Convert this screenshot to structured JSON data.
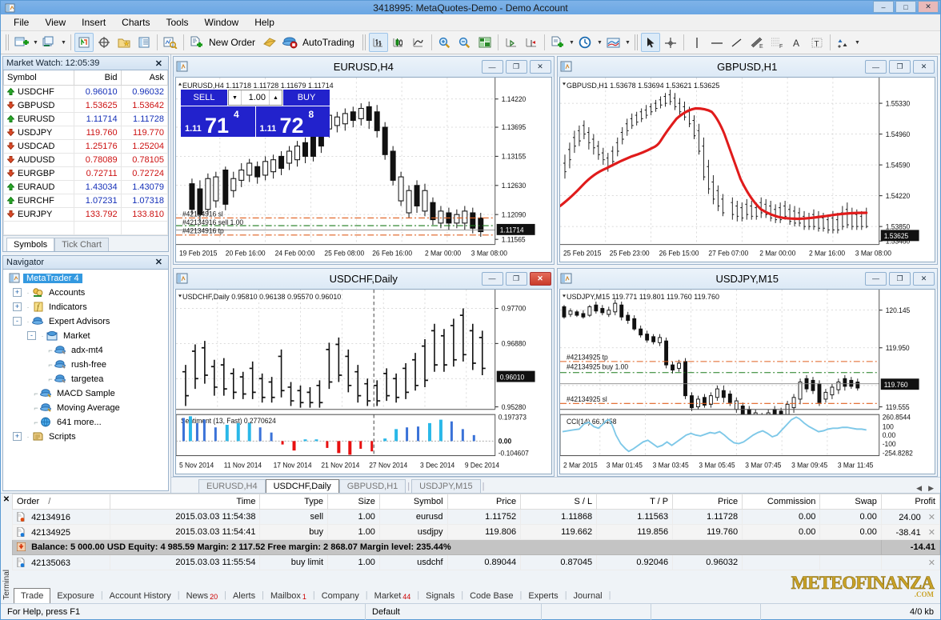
{
  "window": {
    "title": "3418995: MetaQuotes-Demo - Demo Account",
    "minimize": "–",
    "maximize": "□",
    "close": "✕"
  },
  "menu": [
    "File",
    "View",
    "Insert",
    "Charts",
    "Tools",
    "Window",
    "Help"
  ],
  "toolbar": {
    "new_order_label": "New Order",
    "autotrading_label": "AutoTrading",
    "icons": [
      "new-chart-icon",
      "dropdown-caret",
      "profiles-icon",
      "dropdown-caret",
      "market-watch-icon",
      "data-window-icon",
      "navigator-icon",
      "terminal-icon",
      "strategy-tester-icon",
      "new-order-icon",
      "metaeditor-icon",
      "autotrading-icon",
      "bar-chart-icon",
      "candlestick-chart-icon",
      "line-chart-icon",
      "zoom-in-icon",
      "zoom-out-icon",
      "tile-windows-icon",
      "auto-scroll-icon",
      "chart-shift-icon",
      "templates-icon",
      "timeframes-icon",
      "indicators-icon",
      "cursor-icon",
      "crosshair-icon",
      "vertical-line-icon",
      "horizontal-line-icon",
      "trendline-icon",
      "equidistant-channel-icon",
      "fibonacci-icon",
      "text-icon",
      "text-label-icon",
      "objects-icon"
    ]
  },
  "market_watch": {
    "title": "Market Watch: 12:05:39",
    "close": "✕",
    "columns": [
      "Symbol",
      "Bid",
      "Ask"
    ],
    "rows": [
      {
        "symbol": "USDCHF",
        "bid": "0.96010",
        "ask": "0.96032",
        "dir": "up"
      },
      {
        "symbol": "GBPUSD",
        "bid": "1.53625",
        "ask": "1.53642",
        "dir": "down"
      },
      {
        "symbol": "EURUSD",
        "bid": "1.11714",
        "ask": "1.11728",
        "dir": "up"
      },
      {
        "symbol": "USDJPY",
        "bid": "119.760",
        "ask": "119.770",
        "dir": "down"
      },
      {
        "symbol": "USDCAD",
        "bid": "1.25176",
        "ask": "1.25204",
        "dir": "down"
      },
      {
        "symbol": "AUDUSD",
        "bid": "0.78089",
        "ask": "0.78105",
        "dir": "down"
      },
      {
        "symbol": "EURGBP",
        "bid": "0.72711",
        "ask": "0.72724",
        "dir": "down"
      },
      {
        "symbol": "EURAUD",
        "bid": "1.43034",
        "ask": "1.43079",
        "dir": "up"
      },
      {
        "symbol": "EURCHF",
        "bid": "1.07231",
        "ask": "1.07318",
        "dir": "up"
      },
      {
        "symbol": "EURJPY",
        "bid": "133.792",
        "ask": "133.810",
        "dir": "down"
      }
    ],
    "tabs": [
      {
        "label": "Symbols",
        "active": true
      },
      {
        "label": "Tick Chart",
        "active": false
      }
    ]
  },
  "navigator": {
    "title": "Navigator",
    "close": "✕",
    "tree": [
      {
        "label": "MetaTrader 4",
        "indent": 0,
        "expander": "",
        "icon": "mt4-icon",
        "selected": true
      },
      {
        "label": "Accounts",
        "indent": 1,
        "expander": "+",
        "icon": "accounts-icon"
      },
      {
        "label": "Indicators",
        "indent": 1,
        "expander": "+",
        "icon": "indicators-icon"
      },
      {
        "label": "Expert Advisors",
        "indent": 1,
        "expander": "-",
        "icon": "expert-icon"
      },
      {
        "label": "Market",
        "indent": 2,
        "expander": "-",
        "icon": "market-folder-icon"
      },
      {
        "label": "adx-mt4",
        "indent": 3,
        "expander": "",
        "icon": "ea-icon"
      },
      {
        "label": "rush-free",
        "indent": 3,
        "expander": "",
        "icon": "ea-icon"
      },
      {
        "label": "targetea",
        "indent": 3,
        "expander": "",
        "icon": "ea-icon"
      },
      {
        "label": "MACD Sample",
        "indent": 2,
        "expander": "",
        "icon": "ea-icon"
      },
      {
        "label": "Moving Average",
        "indent": 2,
        "expander": "",
        "icon": "ea-icon"
      },
      {
        "label": "641 more...",
        "indent": 2,
        "expander": "",
        "icon": "globe-icon"
      },
      {
        "label": "Scripts",
        "indent": 1,
        "expander": "+",
        "icon": "scripts-icon"
      }
    ]
  },
  "charts": [
    {
      "title": "EURUSD,H4",
      "ohlc": "EURUSD,H4  1.11718 1.11728 1.11679 1.11714",
      "arrow": "▲",
      "active_close": false,
      "price_labels": [
        "1.14220",
        "1.13695",
        "1.13155",
        "1.12630",
        "1.12090",
        "1.11565"
      ],
      "current_price": "1.11714",
      "time_labels": [
        "19 Feb 2015",
        "20 Feb 16:00",
        "24 Feb 00:00",
        "25 Feb 08:00",
        "26 Feb 16:00",
        "2 Mar 00:00",
        "3 Mar 08:00"
      ],
      "object_labels": [
        "#42134916 sl",
        "#42134916 sell 1.00",
        "#42134916 tp"
      ],
      "one_click": {
        "sell_label": "SELL",
        "buy_label": "BUY",
        "volume": "1.00",
        "sell_big": "1.11",
        "sell_mid": "71",
        "sell_sup": "4",
        "buy_big": "1.11",
        "buy_mid": "72",
        "buy_sup": "8",
        "down_caret": "▼",
        "up_caret": "▲"
      }
    },
    {
      "title": "GBPUSD,H1",
      "ohlc": "GBPUSD,H1  1.53678 1.53694 1.53621 1.53625",
      "arrow": "▼",
      "active_close": false,
      "price_labels": [
        "1.55330",
        "1.54960",
        "1.54590",
        "1.54220",
        "1.53850",
        "1.53480"
      ],
      "current_price": "1.53625",
      "time_labels": [
        "25 Feb 2015",
        "25 Feb 23:00",
        "26 Feb 15:00",
        "27 Feb 07:00",
        "2 Mar 00:00",
        "2 Mar 16:00",
        "3 Mar 08:00"
      ],
      "object_labels": []
    },
    {
      "title": "USDCHF,Daily",
      "ohlc": "USDCHF,Daily  0.95810 0.96138 0.95570 0.96010",
      "arrow": "▼",
      "active_close": true,
      "price_labels": [
        "0.97700",
        "0.96880",
        "0.95280"
      ],
      "current_price": "0.96010",
      "time_labels": [
        "5 Nov 2014",
        "11 Nov 2014",
        "17 Nov 2014",
        "21 Nov 2014",
        "27 Nov 2014",
        "3 Dec 2014",
        "9 Dec 2014"
      ],
      "indicator": {
        "label": "Sentiment (13, Fast) 0.2770624",
        "levels": [
          "0.197373",
          "0.00",
          "-0.104607"
        ]
      }
    },
    {
      "title": "USDJPY,M15",
      "ohlc": "USDJPY,M15  119.771 119.801 119.760 119.760",
      "arrow": "▼",
      "active_close": false,
      "price_labels": [
        "120.145",
        "119.950",
        "119.555"
      ],
      "current_price": "119.760",
      "time_labels": [
        "2 Mar 2015",
        "3 Mar 01:45",
        "3 Mar 03:45",
        "3 Mar 05:45",
        "3 Mar 07:45",
        "3 Mar 09:45",
        "3 Mar 11:45"
      ],
      "object_labels": [
        "#42134925 tp",
        "#42134925 buy 1.00",
        "#42134925 sl"
      ],
      "indicator": {
        "label": "CCI(14) 66.1458",
        "levels": [
          "260.8544",
          "100",
          "0.00",
          "-100",
          "-254.8282"
        ]
      }
    }
  ],
  "chart_tabs": [
    {
      "label": "EURUSD,H4",
      "active": false
    },
    {
      "label": "USDCHF,Daily",
      "active": true
    },
    {
      "label": "GBPUSD,H1",
      "active": false
    },
    {
      "label": "USDJPY,M15",
      "active": false
    }
  ],
  "terminal": {
    "close": "✕",
    "side_label": "Terminal",
    "columns": [
      "Order",
      "Time",
      "Type",
      "Size",
      "Symbol",
      "Price",
      "S / L",
      "T / P",
      "Price",
      "Commission",
      "Swap",
      "Profit"
    ],
    "sort_marker": "/",
    "rows": [
      {
        "order": "42134916",
        "time": "2015.03.03 11:54:38",
        "type": "sell",
        "size": "1.00",
        "symbol": "eurusd",
        "price": "1.11752",
        "sl": "1.11868",
        "tp": "1.11563",
        "price2": "1.11728",
        "commission": "0.00",
        "swap": "0.00",
        "profit": "24.00",
        "icon": "sell-order-icon",
        "highlight": false
      },
      {
        "order": "42134925",
        "time": "2015.03.03 11:54:41",
        "type": "buy",
        "size": "1.00",
        "symbol": "usdjpy",
        "price": "119.806",
        "sl": "119.662",
        "tp": "119.856",
        "price2": "119.760",
        "commission": "0.00",
        "swap": "0.00",
        "profit": "-38.41",
        "icon": "buy-order-icon",
        "highlight": true
      },
      {
        "order": "42135063",
        "time": "2015.03.03 11:55:54",
        "type": "buy limit",
        "size": "1.00",
        "symbol": "usdchf",
        "price": "0.89044",
        "sl": "0.87045",
        "tp": "0.92046",
        "price2": "0.96032",
        "commission": "",
        "swap": "",
        "profit": "",
        "icon": "pending-order-icon",
        "highlight": false
      }
    ],
    "balance_row": {
      "text": "Balance: 5 000.00 USD  Equity: 4 985.59  Margin: 2 117.52  Free margin: 2 868.07  Margin level: 235.44%",
      "total": "-14.41"
    },
    "tabs": [
      {
        "label": "Trade",
        "badge": "",
        "active": true
      },
      {
        "label": "Exposure",
        "badge": "",
        "active": false
      },
      {
        "label": "Account History",
        "badge": "",
        "active": false
      },
      {
        "label": "News",
        "badge": "20",
        "active": false
      },
      {
        "label": "Alerts",
        "badge": "",
        "active": false
      },
      {
        "label": "Mailbox",
        "badge": "1",
        "active": false
      },
      {
        "label": "Company",
        "badge": "",
        "active": false
      },
      {
        "label": "Market",
        "badge": "44",
        "active": false
      },
      {
        "label": "Signals",
        "badge": "",
        "active": false
      },
      {
        "label": "Code Base",
        "badge": "",
        "active": false
      },
      {
        "label": "Experts",
        "badge": "",
        "active": false
      },
      {
        "label": "Journal",
        "badge": "",
        "active": false
      }
    ]
  },
  "status_bar": {
    "help": "For Help, press F1",
    "profile": "Default",
    "traffic": "4/0 kb"
  },
  "watermark": {
    "line1": "METEOFINANZA",
    "line2": ".COM"
  },
  "colors": {
    "accent": "#3399e0",
    "bid_up": "#1530b8",
    "bid_down": "#cc1111",
    "buy_panel": "#2222cc",
    "ma_line": "#e01b1b",
    "cci_line": "#7ec8e8",
    "sentiment_pos": "#3a72d8",
    "sentiment_pos2": "#2ab8e8",
    "sentiment_neg": "#e81010"
  },
  "chart_data": [
    {
      "type": "candlestick",
      "title": "EURUSD,H4",
      "ylim": [
        1.114,
        1.144
      ],
      "ytick": [
        1.1422,
        1.13695,
        1.13155,
        1.1263,
        1.1209,
        1.11565
      ],
      "xlabels": [
        "19 Feb 2015",
        "20 Feb 16:00",
        "24 Feb 00:00",
        "25 Feb 08:00",
        "26 Feb 16:00",
        "2 Mar 00:00",
        "3 Mar 08:00"
      ],
      "last": 1.11714,
      "levels": [
        {
          "name": "sl",
          "value": 1.11868,
          "color": "#e06020"
        },
        {
          "name": "sell",
          "value": 1.11752,
          "color": "#1b7a1b"
        },
        {
          "name": "tp",
          "value": 1.11563,
          "color": "#e06020"
        }
      ]
    },
    {
      "type": "line+candlestick",
      "title": "GBPUSD,H1",
      "ylim": [
        1.533,
        1.555
      ],
      "ytick": [
        1.5533,
        1.5496,
        1.5459,
        1.5422,
        1.5385,
        1.5348
      ],
      "xlabels": [
        "25 Feb 2015",
        "25 Feb 23:00",
        "26 Feb 15:00",
        "27 Feb 07:00",
        "2 Mar 00:00",
        "2 Mar 16:00",
        "3 Mar 08:00"
      ],
      "last": 1.53625,
      "overlay": "moving-average"
    },
    {
      "type": "bar",
      "title": "USDCHF,Daily",
      "ylim": [
        0.95,
        0.982
      ],
      "ytick": [
        0.977,
        0.9688,
        0.9528
      ],
      "xlabels": [
        "5 Nov 2014",
        "11 Nov 2014",
        "17 Nov 2014",
        "21 Nov 2014",
        "27 Nov 2014",
        "3 Dec 2014",
        "9 Dec 2014"
      ],
      "last": 0.9601,
      "subchart": {
        "type": "histogram",
        "name": "Sentiment (13, Fast)",
        "value": 0.2770624,
        "ylim": [
          -0.104607,
          0.197373
        ],
        "ytick": [
          0.197373,
          0.0,
          -0.104607
        ]
      }
    },
    {
      "type": "candlestick",
      "title": "USDJPY,M15",
      "ylim": [
        119.5,
        120.25
      ],
      "ytick": [
        120.145,
        119.95,
        119.555
      ],
      "xlabels": [
        "2 Mar 2015",
        "3 Mar 01:45",
        "3 Mar 03:45",
        "3 Mar 05:45",
        "3 Mar 07:45",
        "3 Mar 09:45",
        "3 Mar 11:45"
      ],
      "last": 119.76,
      "levels": [
        {
          "name": "tp",
          "value": 119.856,
          "color": "#e06020"
        },
        {
          "name": "buy",
          "value": 119.806,
          "color": "#1b7a1b"
        },
        {
          "name": "sl",
          "value": 119.662,
          "color": "#e06020"
        }
      ],
      "subchart": {
        "type": "line",
        "name": "CCI(14)",
        "value": 66.1458,
        "ylim": [
          -254.8282,
          260.8544
        ],
        "ytick": [
          260.8544,
          100,
          0.0,
          -100,
          -254.8282
        ]
      }
    }
  ]
}
